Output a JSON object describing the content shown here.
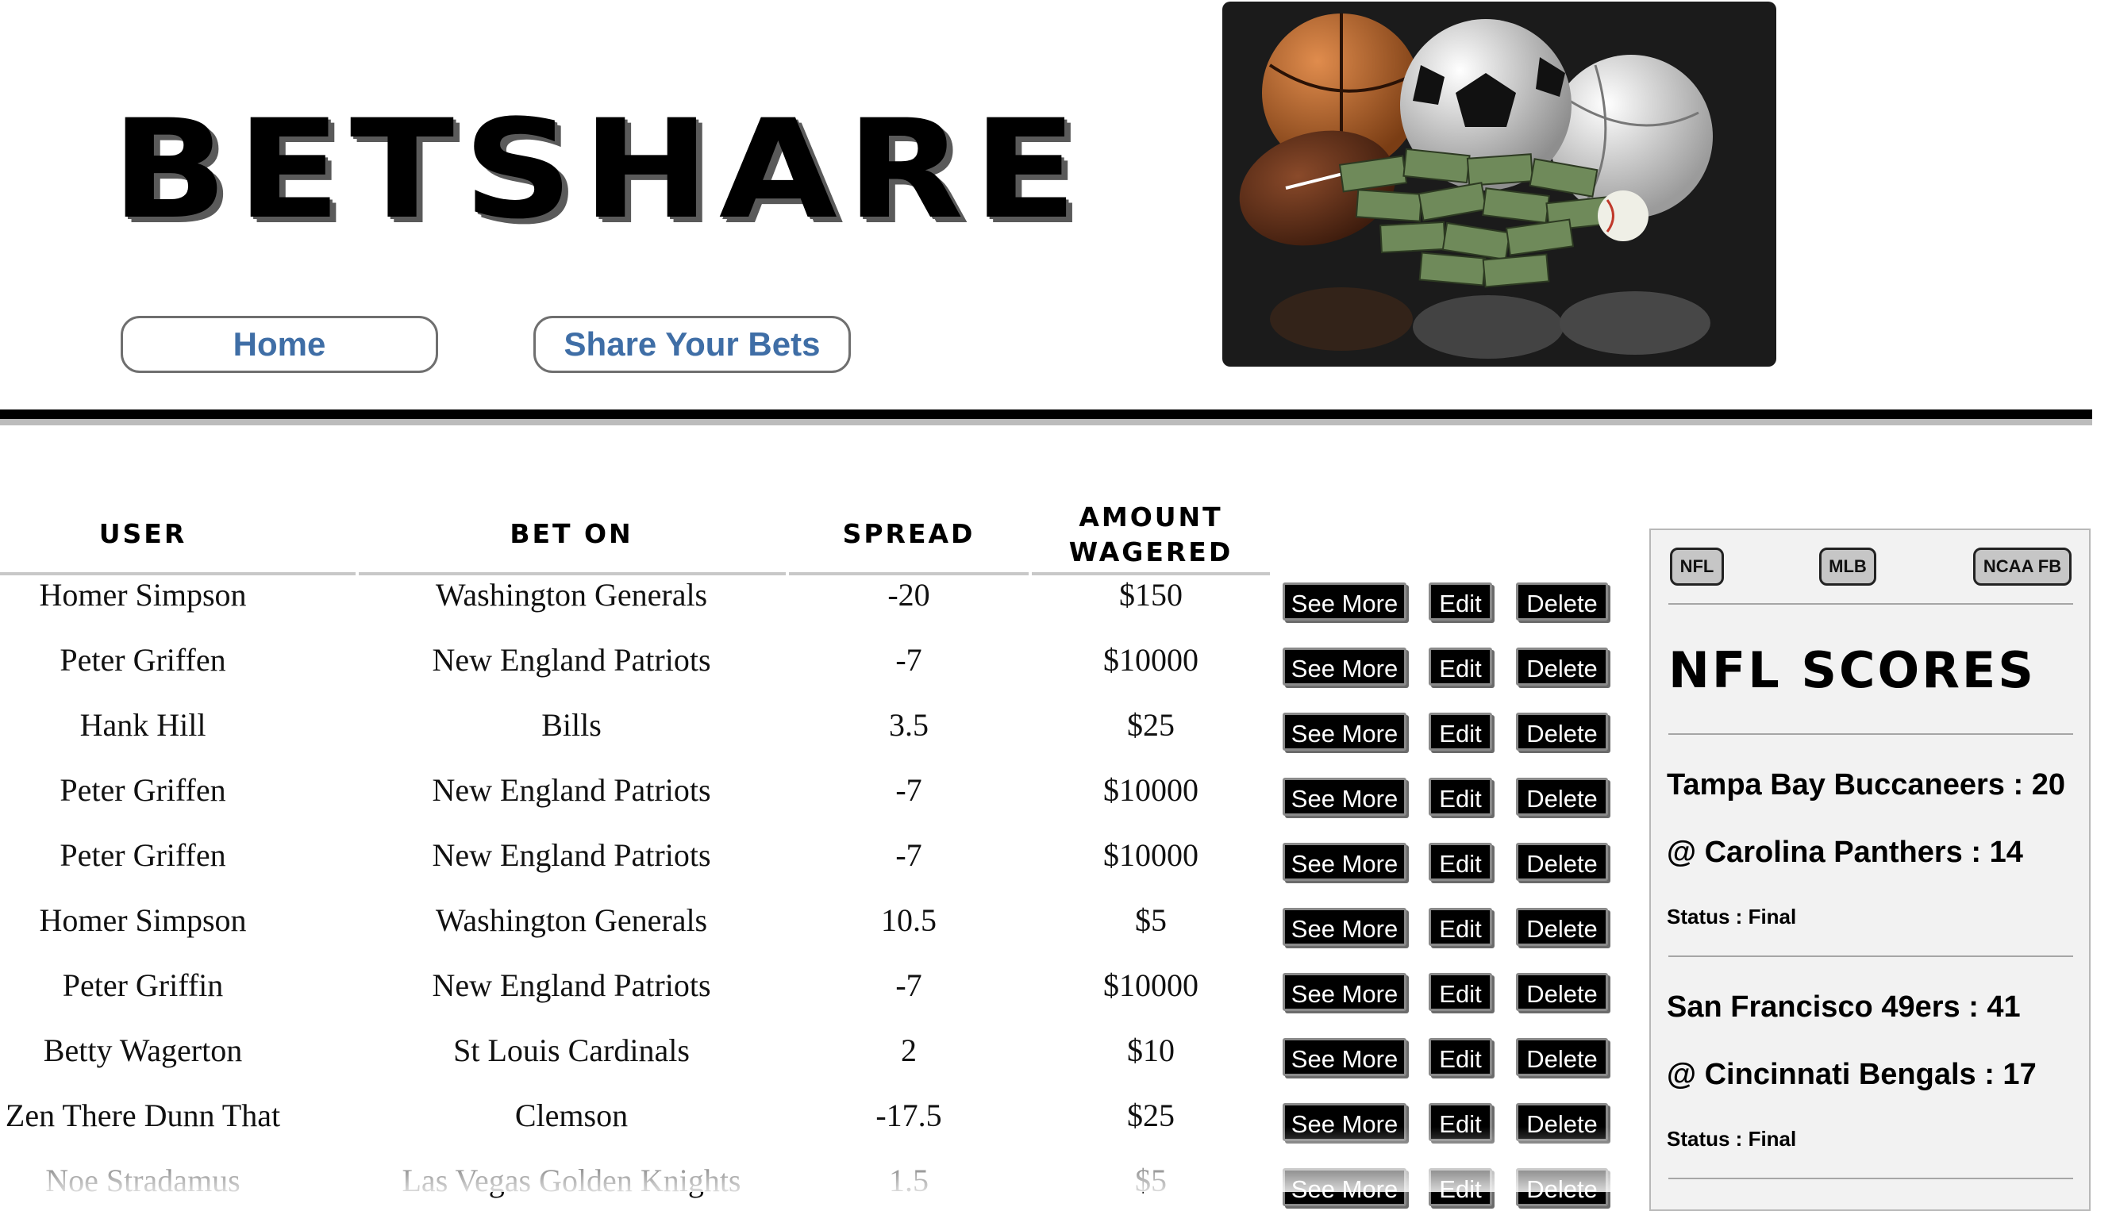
{
  "app": {
    "title": "BETSHARE"
  },
  "nav": {
    "home": "Home",
    "share": "Share Your Bets"
  },
  "table": {
    "headers": [
      "USER",
      "BET ON",
      "SPREAD",
      "AMOUNT WAGERED"
    ],
    "actions": {
      "see_more": "See More",
      "edit": "Edit",
      "delete": "Delete"
    },
    "rows": [
      {
        "user": "Homer Simpson",
        "bet_on": "Washington Generals",
        "spread": "-20",
        "amount": "$150"
      },
      {
        "user": "Peter Griffen",
        "bet_on": "New England Patriots",
        "spread": "-7",
        "amount": "$10000"
      },
      {
        "user": "Hank Hill",
        "bet_on": "Bills",
        "spread": "3.5",
        "amount": "$25"
      },
      {
        "user": "Peter Griffen",
        "bet_on": "New England Patriots",
        "spread": "-7",
        "amount": "$10000"
      },
      {
        "user": "Peter Griffen",
        "bet_on": "New England Patriots",
        "spread": "-7",
        "amount": "$10000"
      },
      {
        "user": "Homer Simpson",
        "bet_on": "Washington Generals",
        "spread": "10.5",
        "amount": "$5"
      },
      {
        "user": "Peter Griffin",
        "bet_on": "New England Patriots",
        "spread": "-7",
        "amount": "$10000"
      },
      {
        "user": "Betty Wagerton",
        "bet_on": "St Louis Cardinals",
        "spread": "2",
        "amount": "$10"
      },
      {
        "user": "Zen There Dunn That",
        "bet_on": "Clemson",
        "spread": "-17.5",
        "amount": "$25"
      },
      {
        "user": "Noe Stradamus",
        "bet_on": "Las Vegas Golden Knights",
        "spread": "1.5",
        "amount": "$5"
      }
    ]
  },
  "scores": {
    "tabs": [
      "NFL",
      "MLB",
      "NCAA FB"
    ],
    "title": "NFL SCORES",
    "games": [
      {
        "home": "Tampa Bay Buccaneers : 20",
        "away": "@  Carolina Panthers : 14",
        "status": "Status : Final"
      },
      {
        "home": "San Francisco 49ers : 41",
        "away": "@  Cincinnati Bengals : 17",
        "status": "Status : Final"
      }
    ]
  }
}
